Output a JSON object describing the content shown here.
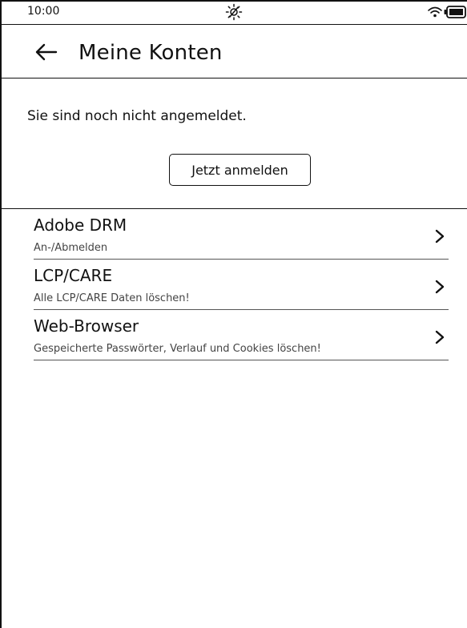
{
  "status_bar": {
    "time": "10:00",
    "icons": [
      "frontlight-off-icon",
      "wifi-icon",
      "battery-icon"
    ]
  },
  "header": {
    "back_icon": "arrow-left-icon",
    "title": "Meine Konten"
  },
  "login": {
    "message": "Sie sind noch nicht angemeldet.",
    "button_label": "Jetzt anmelden"
  },
  "menu": {
    "items": [
      {
        "title": "Adobe DRM",
        "subtitle": "An-/Abmelden",
        "icon": "chevron-right-icon"
      },
      {
        "title": "LCP/CARE",
        "subtitle": "Alle LCP/CARE Daten löschen!",
        "icon": "chevron-right-icon"
      },
      {
        "title": "Web-Browser",
        "subtitle": "Gespeicherte Passwörter, Verlauf und Cookies löschen!",
        "icon": "chevron-right-icon"
      }
    ]
  },
  "colors": {
    "foreground": "#111111",
    "background": "#ffffff",
    "secondary_text": "#444444"
  }
}
